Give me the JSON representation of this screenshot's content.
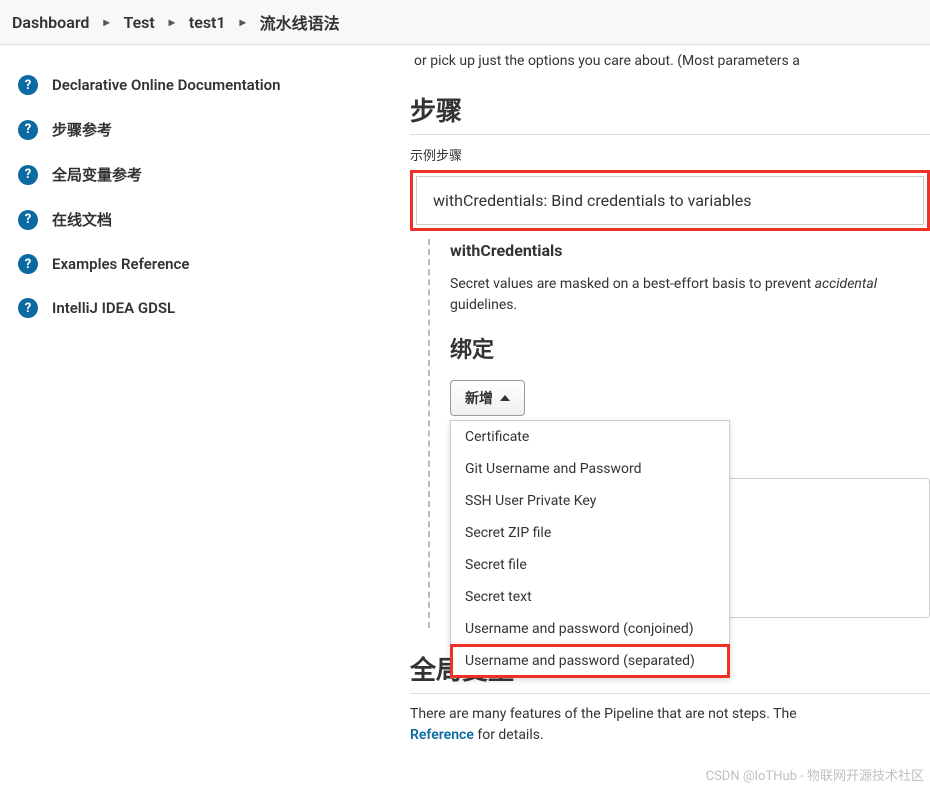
{
  "breadcrumb": [
    {
      "label": "Dashboard"
    },
    {
      "label": "Test"
    },
    {
      "label": "test1"
    },
    {
      "label": "流水线语法"
    }
  ],
  "sidebar": {
    "items": [
      {
        "label": "Declarative Online Documentation"
      },
      {
        "label": "步骤参考"
      },
      {
        "label": "全局变量参考"
      },
      {
        "label": "在线文档"
      },
      {
        "label": "Examples Reference"
      },
      {
        "label": "IntelliJ IDEA GDSL"
      }
    ]
  },
  "main": {
    "intro": "or pick up just the options you care about. (Most parameters a",
    "steps_heading": "步骤",
    "sample_step_label": "示例步骤",
    "step_select_value": "withCredentials: Bind credentials to variables",
    "step_title": "withCredentials",
    "step_desc_prefix": "Secret values are masked on a best-effort basis to prevent ",
    "step_desc_italic": "accidental",
    "step_desc_suffix": " guidelines.",
    "bindings_heading": "绑定",
    "add_button": "新增",
    "dropdown_options": [
      "Certificate",
      "Git Username and Password",
      "SSH User Private Key",
      "Secret ZIP file",
      "Secret file",
      "Secret text",
      "Username and password (conjoined)",
      "Username and password (separated)"
    ],
    "globals_heading": "全局变量",
    "footer_prefix": "There are many features of the Pipeline that are not steps. The",
    "footer_link": "Reference",
    "footer_suffix": " for details.",
    "watermark": "CSDN @IoTHub - 物联网开源技术社区"
  }
}
